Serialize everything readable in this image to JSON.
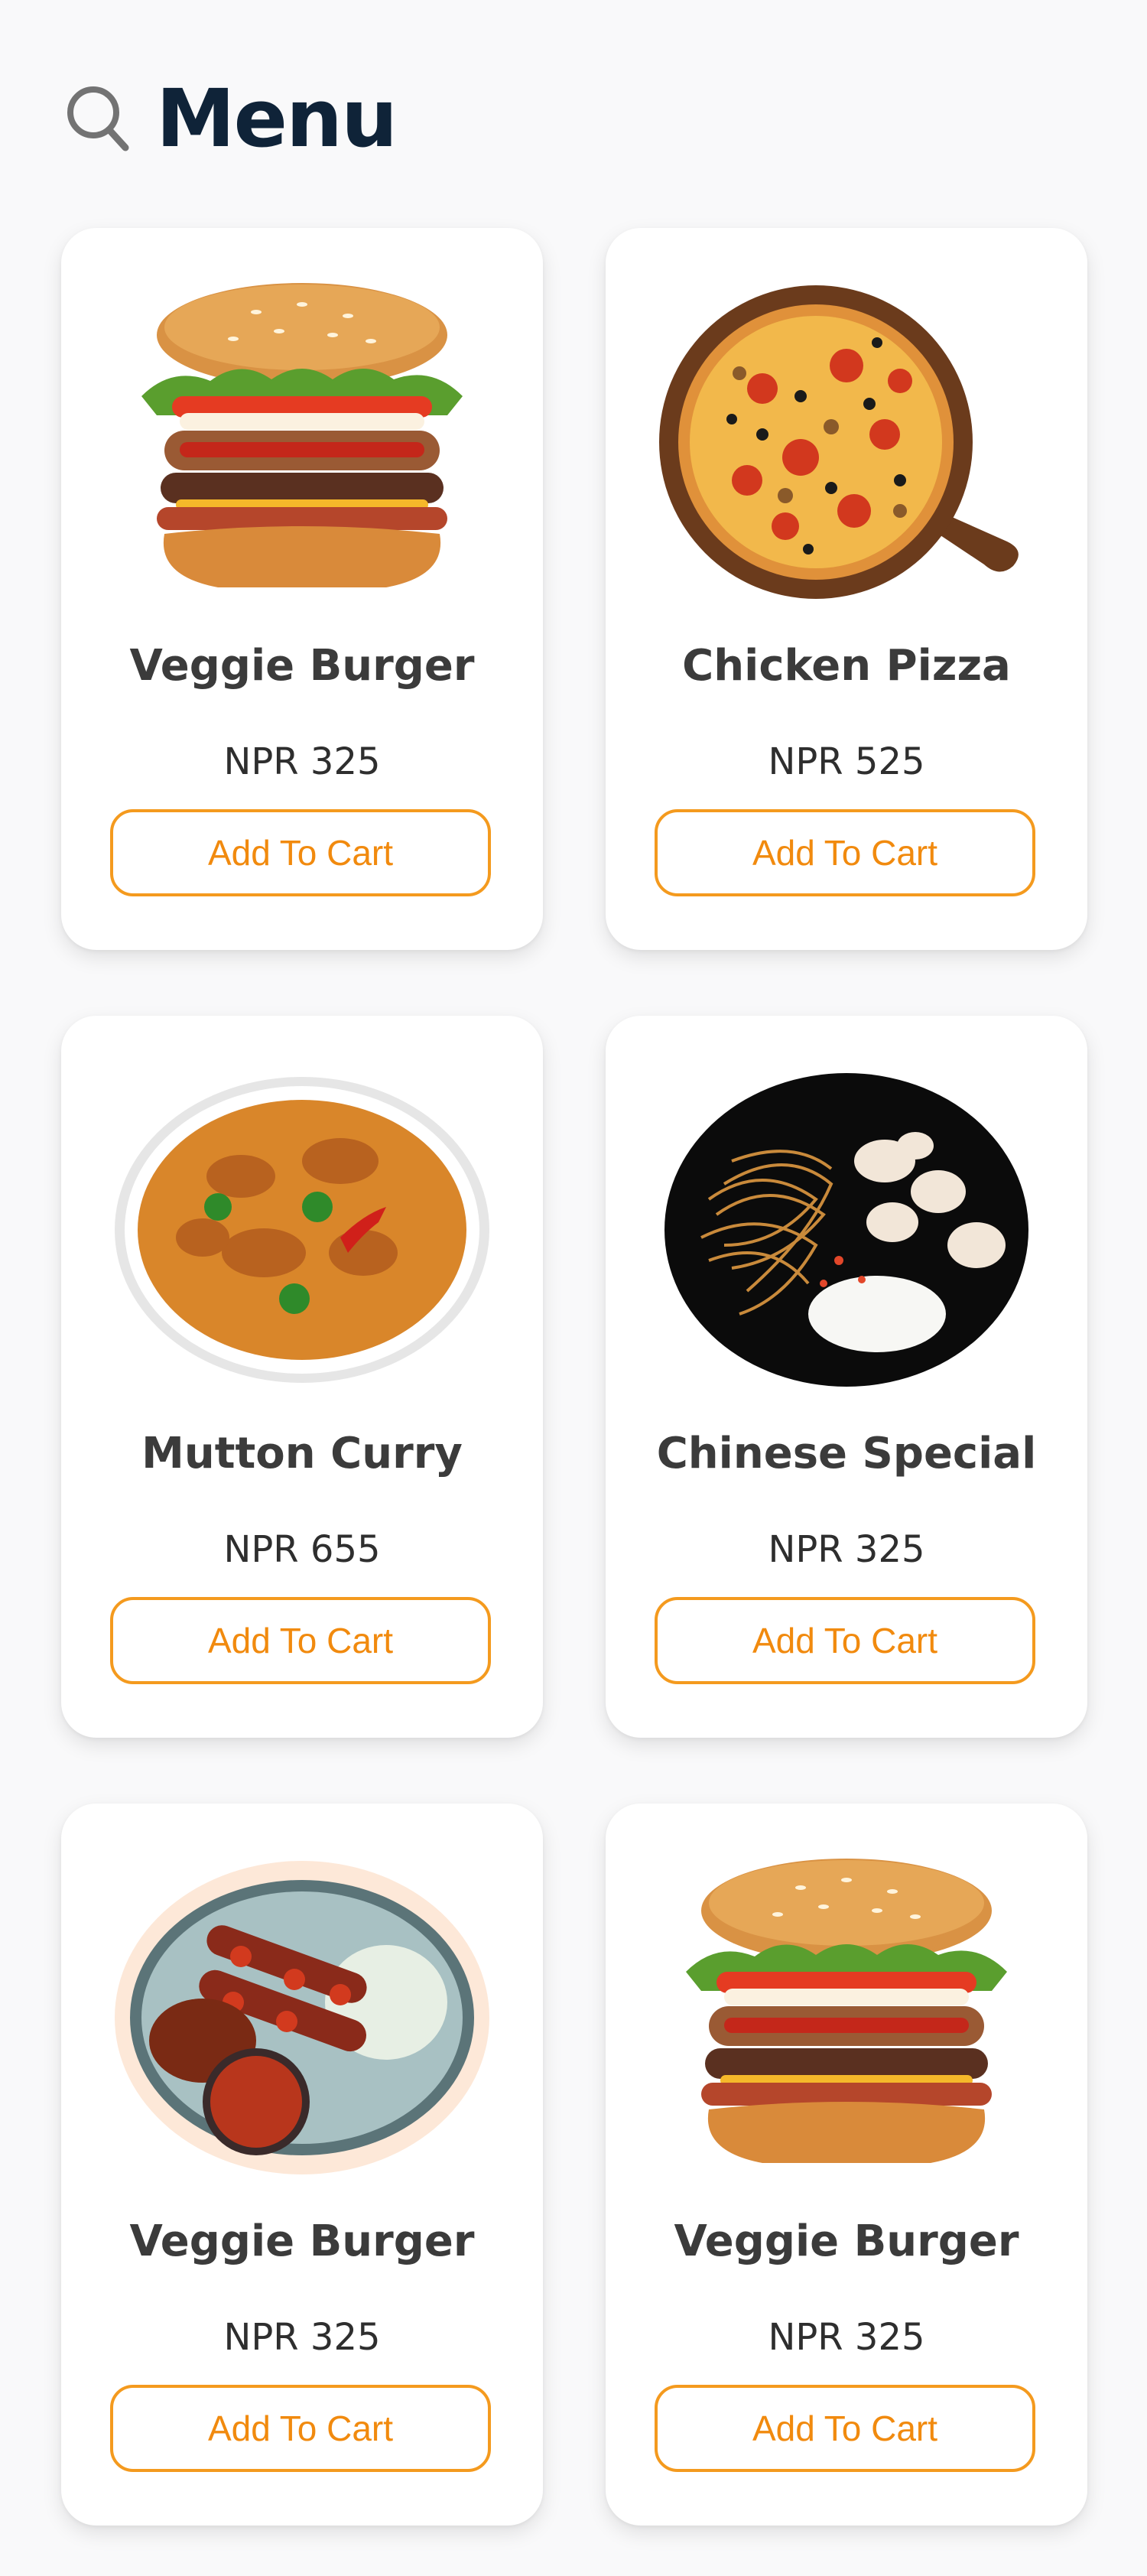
{
  "header": {
    "title": "Menu",
    "icon": "search-icon"
  },
  "theme": {
    "accent": "#f18a0e",
    "title_color": "#0f2338",
    "background": "#f9f9fa"
  },
  "menu": {
    "items": [
      {
        "name": "Veggie Burger",
        "price": "NPR 325",
        "button": "Add To Cart",
        "image": "burger"
      },
      {
        "name": "Chicken Pizza",
        "price": "NPR 525",
        "button": "Add To Cart",
        "image": "pizza"
      },
      {
        "name": "Mutton Curry",
        "price": "NPR 655",
        "button": "Add To Cart",
        "image": "curry"
      },
      {
        "name": "Chinese Special",
        "price": "NPR 325",
        "button": "Add To Cart",
        "image": "noodles"
      },
      {
        "name": "Veggie Burger",
        "price": "NPR 325",
        "button": "Add To Cart",
        "image": "skewers"
      },
      {
        "name": "Veggie Burger",
        "price": "NPR 325",
        "button": "Add To Cart",
        "image": "burger"
      }
    ]
  }
}
